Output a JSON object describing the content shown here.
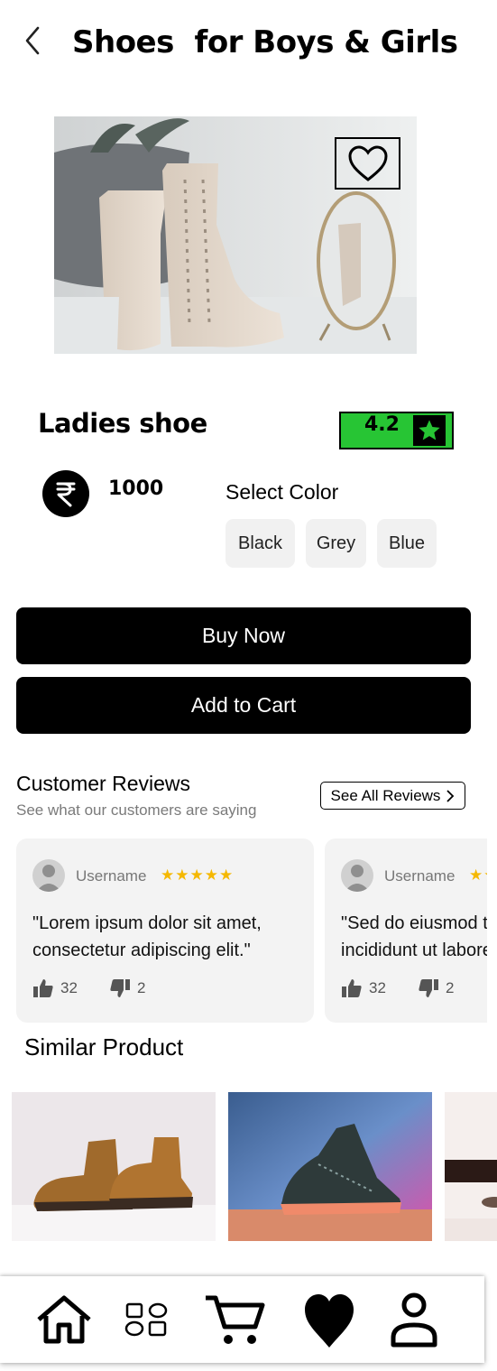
{
  "header": {
    "title": "Shoes  for Boys & Girls",
    "back_icon": "chevron-left-icon"
  },
  "hero": {
    "favorite_icon": "heart-outline-icon"
  },
  "product": {
    "name": "Ladies shoe",
    "rating": "4.2",
    "rating_icon": "star-icon",
    "rating_color": "#27c534",
    "currency_icon": "rupee-icon",
    "price": "1000",
    "color_label": "Select Color",
    "colors": [
      "Black",
      "Grey",
      "Blue"
    ]
  },
  "actions": {
    "buy_now": "Buy Now",
    "add_to_cart": "Add to Cart"
  },
  "reviews": {
    "title": "Customer Reviews",
    "subtitle": "See what our customers are saying",
    "see_all": "See All Reviews",
    "star_color": "#f5b800",
    "items": [
      {
        "username": "Username",
        "stars": "★★★★★",
        "line1": "\"Lorem ipsum dolor sit amet,",
        "line2": "consectetur adipiscing elit.\"",
        "likes": "32",
        "dislikes": "2"
      },
      {
        "username": "Username",
        "stars": "★★★★★",
        "line1": "\"Sed do eiusmod tempor",
        "line2": "incididunt ut labore et dolore.\"",
        "likes": "32",
        "dislikes": "2"
      }
    ]
  },
  "similar": {
    "title": "Similar Product"
  },
  "bottom_nav": {
    "items": [
      "home-icon",
      "categories-icon",
      "cart-icon",
      "heart-icon",
      "profile-icon"
    ]
  }
}
